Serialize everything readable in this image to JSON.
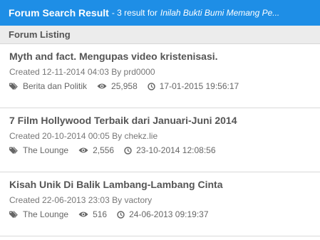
{
  "header": {
    "title": "Forum Search Result",
    "meta": "- 3 result for",
    "query": "Inilah Bukti Bumi Memang Pe..."
  },
  "section": {
    "label": "Forum Listing"
  },
  "threads": [
    {
      "title": "Myth and fact. Mengupas video kristenisasi.",
      "created": "Created 12-11-2014 04:03 By prd0000",
      "category": "Berita dan Politik",
      "views": "25,958",
      "last_post": "17-01-2015 19:56:17"
    },
    {
      "title": "7 Film Hollywood Terbaik dari Januari-Juni 2014",
      "created": "Created 20-10-2014 00:05 By chekz.lie",
      "category": "The Lounge",
      "views": "2,556",
      "last_post": "23-10-2014 12:08:56"
    },
    {
      "title": "Kisah Unik Di Balik Lambang-Lambang Cinta",
      "created": "Created 22-06-2013 23:03 By vactory",
      "category": "The Lounge",
      "views": "516",
      "last_post": "24-06-2013 09:19:37"
    }
  ],
  "colors": {
    "header_bg": "#1e8ee6",
    "subheader_bg": "#ececec"
  }
}
